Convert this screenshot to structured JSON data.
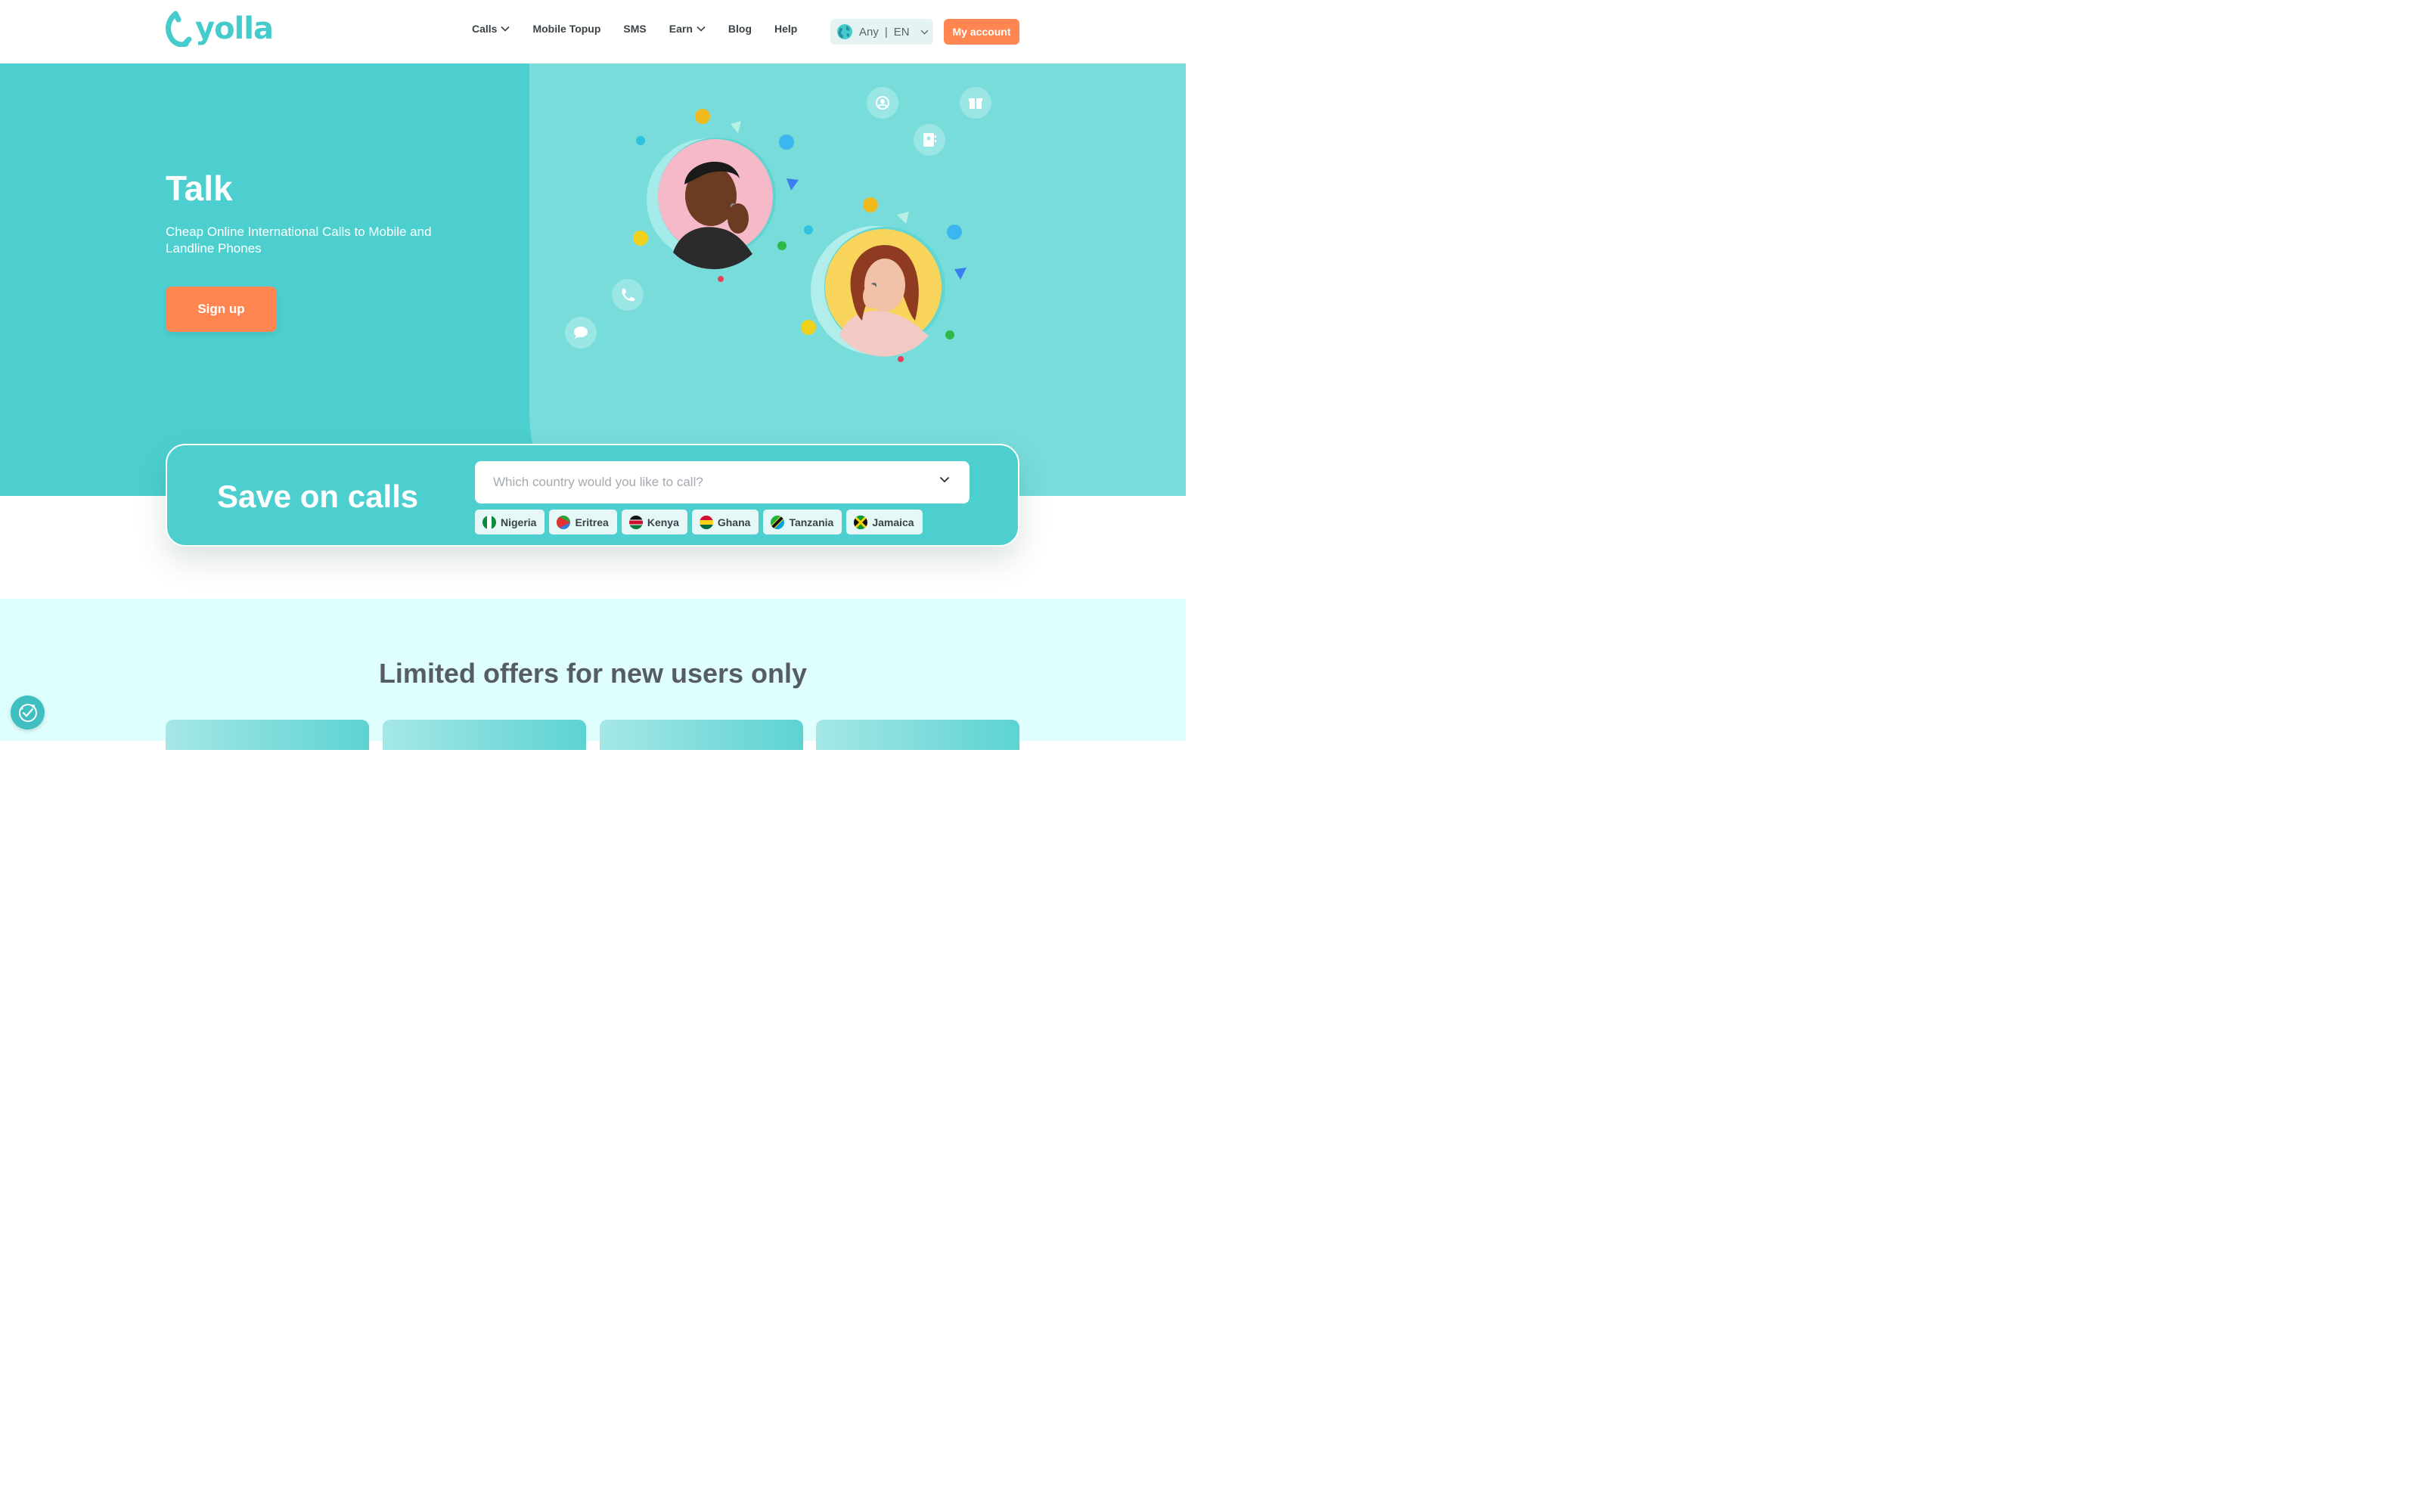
{
  "brand": {
    "name": "yolla",
    "color": "#45cbcb",
    "accent": "#ff8650"
  },
  "header": {
    "nav": [
      {
        "label": "Calls",
        "has_dropdown": true
      },
      {
        "label": "Mobile Topup",
        "has_dropdown": false
      },
      {
        "label": "SMS",
        "has_dropdown": false
      },
      {
        "label": "Earn",
        "has_dropdown": true
      },
      {
        "label": "Blog",
        "has_dropdown": false
      },
      {
        "label": "Help",
        "has_dropdown": false
      }
    ],
    "currency": "Any",
    "language": "EN",
    "my_account": "My account"
  },
  "hero": {
    "title": "Talk",
    "subtitle": "Cheap Online International Calls to Mobile and Landline Phones",
    "signup": "Sign up"
  },
  "save": {
    "title": "Save on calls",
    "placeholder": "Which country would you like to call?",
    "countries": [
      "Nigeria",
      "Eritrea",
      "Kenya",
      "Ghana",
      "Tanzania",
      "Jamaica"
    ]
  },
  "offers": {
    "title": "Limited offers for new users only"
  }
}
